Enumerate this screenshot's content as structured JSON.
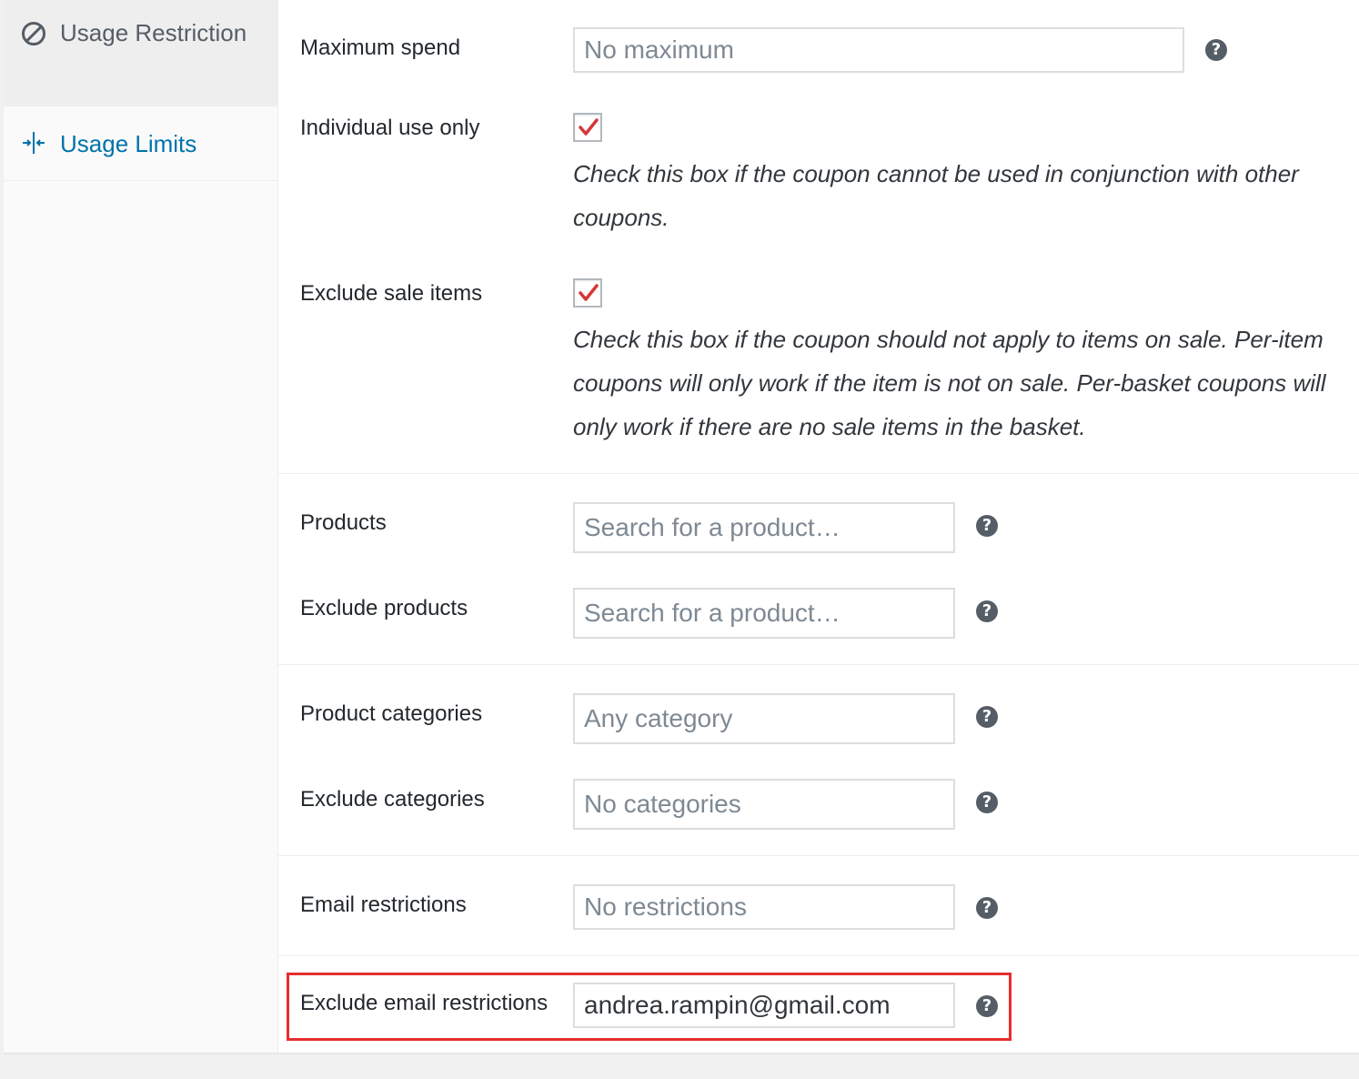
{
  "sidebar": {
    "tabs": [
      {
        "label": "Usage Restriction",
        "icon": "restriction-icon"
      },
      {
        "label": "Usage Limits",
        "icon": "limits-icon"
      }
    ]
  },
  "fields": {
    "maximum_spend": {
      "label": "Maximum spend",
      "placeholder": "No maximum"
    },
    "individual_use": {
      "label": "Individual use only",
      "checked": true,
      "description": "Check this box if the coupon cannot be used in conjunction with other coupons."
    },
    "exclude_sale": {
      "label": "Exclude sale items",
      "checked": true,
      "description": "Check this box if the coupon should not apply to items on sale. Per-item coupons will only work if the item is not on sale. Per-basket coupons will only work if there are no sale items in the basket."
    },
    "products": {
      "label": "Products",
      "placeholder": "Search for a product…"
    },
    "exclude_products": {
      "label": "Exclude products",
      "placeholder": "Search for a product…"
    },
    "product_categories": {
      "label": "Product categories",
      "placeholder": "Any category"
    },
    "exclude_categories": {
      "label": "Exclude categories",
      "placeholder": "No categories"
    },
    "email_restrictions": {
      "label": "Email restrictions",
      "placeholder": "No restrictions"
    },
    "exclude_email_restrictions": {
      "label": "Exclude email restrictions",
      "value": "andrea.rampin@gmail.com"
    }
  },
  "help_glyph": "?",
  "colors": {
    "link": "#0073aa",
    "checkmark": "#d63638",
    "highlight": "#e62e2e"
  }
}
